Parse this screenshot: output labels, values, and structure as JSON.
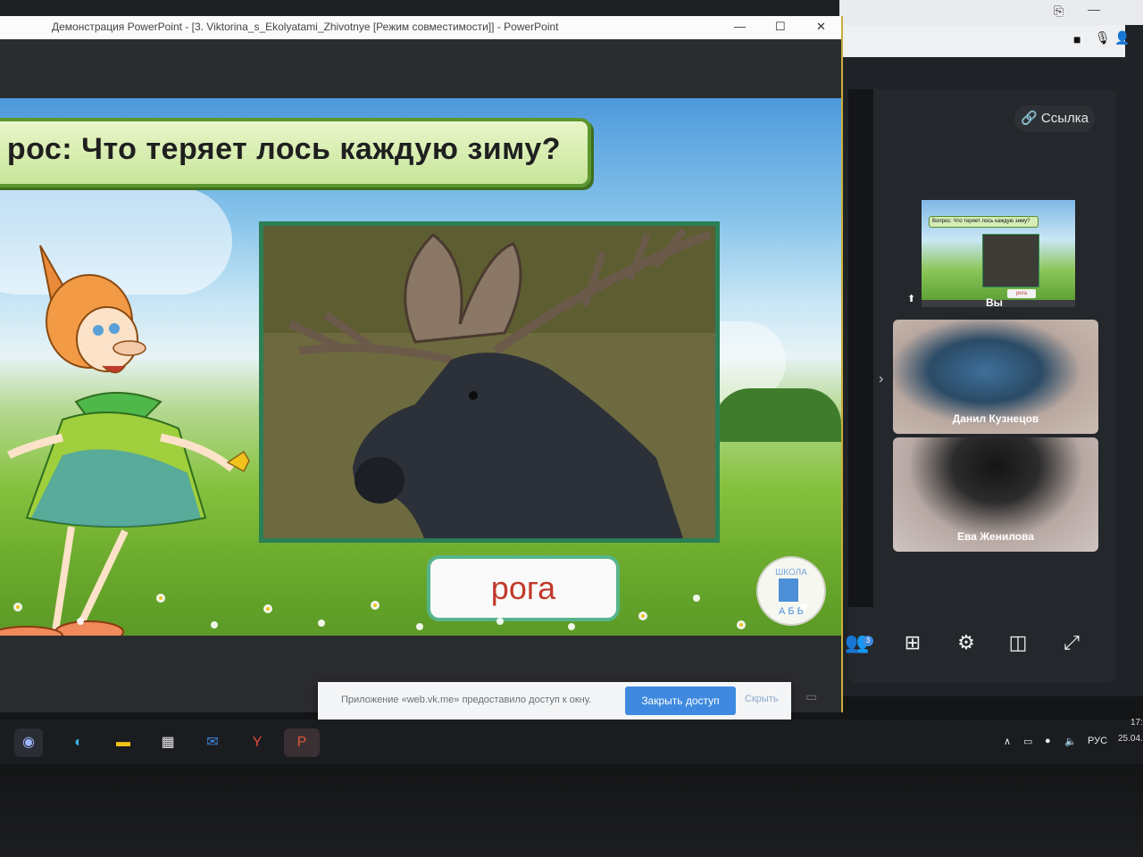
{
  "ppt": {
    "title": "Демонстрация PowerPoint - [3. Viktorina_s_Ekolyatami_Zhivotnye [Режим совместимости]] - PowerPoint",
    "minimize": "—",
    "maximize": "☐",
    "close": "✕"
  },
  "slide": {
    "question": "рос: Что теряет лось каждую зиму?",
    "answer": "рога",
    "logo_text": "ШКОЛА",
    "logo_letters": "А Б В"
  },
  "vk": {
    "link_label": "Ссылка",
    "self_label": "Вы",
    "mini_question": "Вопрос: Что теряет лось каждую зиму?",
    "mini_answer": "рога",
    "participants": [
      {
        "name": "Данил Кузнецов"
      },
      {
        "name": "Ева Женилова"
      }
    ],
    "participants_count": "3",
    "next_arrow": "›"
  },
  "access_bar": {
    "message": "Приложение «web.vk.me» предоставило доступ к окну.",
    "close_label": "Закрыть доступ",
    "hide_label": "Скрыть"
  },
  "taskbar": {
    "lang": "РУС",
    "time": "17:",
    "date": "25.04."
  },
  "colors": {
    "accent": "#3f8ae0",
    "answer_text": "#c0392b",
    "frame_green": "#2b7f55",
    "question_border": "#5c962f"
  }
}
